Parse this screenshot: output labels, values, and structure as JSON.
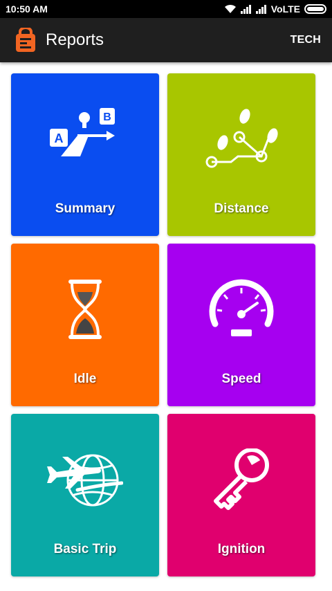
{
  "status_bar": {
    "time": "10:50 AM",
    "network": "VoLTE",
    "icons": [
      "wifi-icon",
      "signal-icon",
      "signal-icon",
      "battery-icon"
    ]
  },
  "app_bar": {
    "title": "Reports",
    "action_label": "TECH",
    "logo": "app-logo-icon",
    "colors": {
      "background": "#1f1f1f",
      "logo": "#f26522"
    }
  },
  "tiles": [
    {
      "label": "Summary",
      "icon": "route-sign-icon",
      "color": "#0a4df0"
    },
    {
      "label": "Distance",
      "icon": "route-pins-icon",
      "color": "#a8c600"
    },
    {
      "label": "Idle",
      "icon": "hourglass-icon",
      "color": "#ff6a00"
    },
    {
      "label": "Speed",
      "icon": "speedometer-icon",
      "color": "#a600f0"
    },
    {
      "label": "Basic Trip",
      "icon": "plane-globe-icon",
      "color": "#0aa9a6"
    },
    {
      "label": "Ignition",
      "icon": "key-icon",
      "color": "#e0006e"
    }
  ]
}
